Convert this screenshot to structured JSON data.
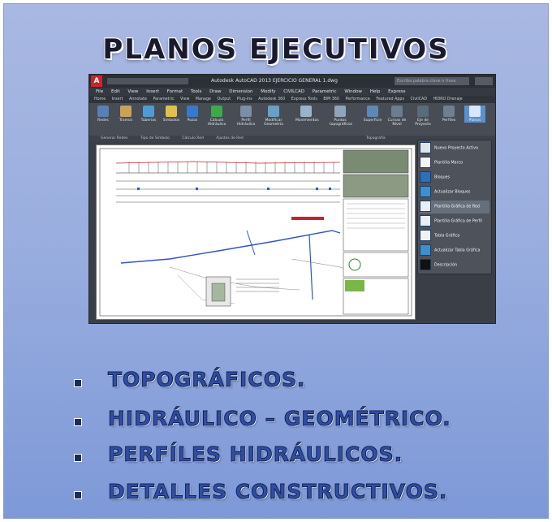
{
  "slide": {
    "title": "PLANOS EJECUTIVOS",
    "bullet_marker": "-",
    "bullets": [
      "TOPOGRÁFICOS.",
      "HIDRÁULICO – GEOMÉTRICO.",
      "PERFÍLES HIDRÁULICOS.",
      "DETALLES CONSTRUCTIVOS."
    ],
    "colors": {
      "background": "#9aaedf",
      "bullet_text": "#2f4ea6",
      "title": "#1a1a2e"
    }
  },
  "screenshot": {
    "app_logo": "A",
    "window_title": "Autodesk AutoCAD 2013   EJERCICIO GENERAL 1.dwg",
    "search_placeholder": "Escriba palabra clave o frase",
    "menu": [
      "File",
      "Edit",
      "View",
      "Insert",
      "Format",
      "Tools",
      "Draw",
      "Dimension",
      "Modify",
      "CIVILCAD",
      "Parametric",
      "Window",
      "Help",
      "Express"
    ],
    "tabs": [
      "Home",
      "Insert",
      "Annotate",
      "Parametric",
      "View",
      "Manage",
      "Output",
      "Plug-ins",
      "Autodesk 360",
      "Express Tools",
      "BIM 360",
      "Performance",
      "Featured Apps",
      "CivilCAD",
      "HIDRO Drenaje"
    ],
    "ribbon_buttons": [
      "Redes",
      "Tramos",
      "Tuberías",
      "Simbolos",
      "Pozos",
      "Cálculo Hidráulico",
      "Perfil Hidráulico",
      "Modificar Geometría",
      "Movimientos",
      "Puntos topográficos",
      "Superficie",
      "Curvas de Nivel",
      "Eje de Proyecto",
      "Perfiles",
      "Planos"
    ],
    "panel_labels": [
      "Generar Redes",
      "Tipo de Símbolo",
      "Cálculo Red",
      "Ajustes de Red",
      "Topografía"
    ],
    "side_menu": [
      "Nuevo Proyecto Activo",
      "Plantilla Marco",
      "Bloques",
      "Actualizar Bloques",
      "Plantilla Gráfica de Red",
      "Plantilla Gráfica de Perfil",
      "Tabla Gráfica",
      "Actualizar Tabla Gráfica",
      "Descripción"
    ]
  }
}
